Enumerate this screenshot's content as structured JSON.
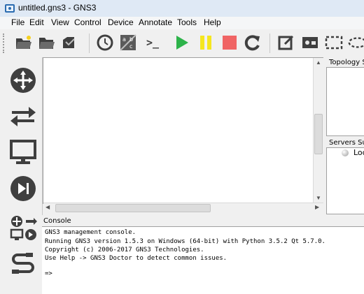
{
  "window": {
    "title": "untitled.gns3 - GNS3"
  },
  "menu": [
    "File",
    "Edit",
    "View",
    "Control",
    "Device",
    "Annotate",
    "Tools",
    "Help"
  ],
  "toolbar": {
    "icons": [
      "open-project-icon",
      "open-folder-icon",
      "snapshot-icon",
      "clock-icon",
      "abc-toggle-icon",
      "terminal-icon",
      "start-icon",
      "pause-icon",
      "stop-icon",
      "reload-icon",
      "edit-note-icon",
      "insert-image-icon",
      "rectangle-icon",
      "ellipse-icon"
    ],
    "terminal_glyph": ">_"
  },
  "dock": {
    "icons": [
      "router-icon",
      "switch-icon",
      "end-device-icon",
      "security-device-icon",
      "all-devices-icon",
      "add-link-icon"
    ]
  },
  "panels": {
    "topology_title": "Topology S",
    "servers_title": "Servers Su",
    "server_item": "Loc"
  },
  "console": {
    "title": "Console",
    "lines": [
      "GNS3 management console.",
      "Running GNS3 version 1.5.3 on Windows (64-bit) with Python 3.5.2 Qt 5.7.0.",
      "Copyright (c) 2006-2017 GNS3 Technologies.",
      "Use Help -> GNS3 Doctor to detect common issues.",
      "",
      "=>"
    ]
  },
  "colors": {
    "play": "#2db34a",
    "pause": "#f5e61e",
    "stop": "#f06464",
    "icon": "#3f3f3f"
  }
}
